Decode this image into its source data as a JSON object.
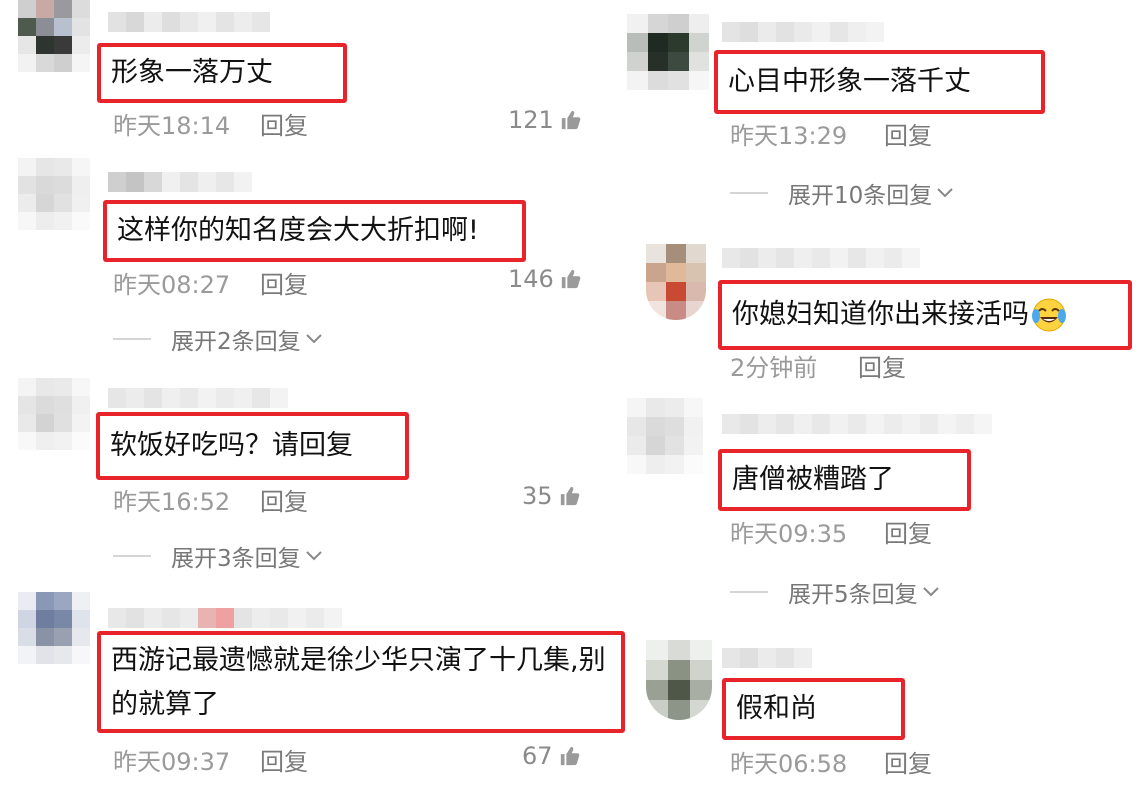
{
  "left": [
    {
      "text": "形象一落万丈",
      "time": "昨天18:14",
      "reply": "回复",
      "likes": "121"
    },
    {
      "text": "这样你的知名度会大大折扣啊!",
      "time": "昨天08:27",
      "reply": "回复",
      "likes": "146",
      "expand": "展开2条回复"
    },
    {
      "text": "软饭好吃吗？请回复",
      "time": "昨天16:52",
      "reply": "回复",
      "likes": "35",
      "expand": "展开3条回复"
    },
    {
      "text": "西游记最遗憾就是徐少华只演了十几集,别的就算了",
      "time": "昨天09:37",
      "reply": "回复",
      "likes": "67"
    }
  ],
  "right": [
    {
      "text": "心目中形象一落千丈",
      "time": "昨天13:29",
      "reply": "回复",
      "expand": "展开10条回复"
    },
    {
      "text": "你媳妇知道你出来接活吗",
      "emoji": "crying-laughing-emoji",
      "time": "2分钟前",
      "reply": "回复"
    },
    {
      "text": "唐僧被糟踏了",
      "time": "昨天09:35",
      "reply": "回复",
      "expand": "展开5条回复"
    },
    {
      "text": "假和尚",
      "time": "昨天06:58",
      "reply": "回复"
    }
  ],
  "colors": {
    "highlight_border": "#e8242a",
    "meta_text": "#9a9a9a"
  },
  "icons": [
    "thumbs-up-icon",
    "chevron-down-icon",
    "blurred-avatar",
    "blurred-username"
  ]
}
